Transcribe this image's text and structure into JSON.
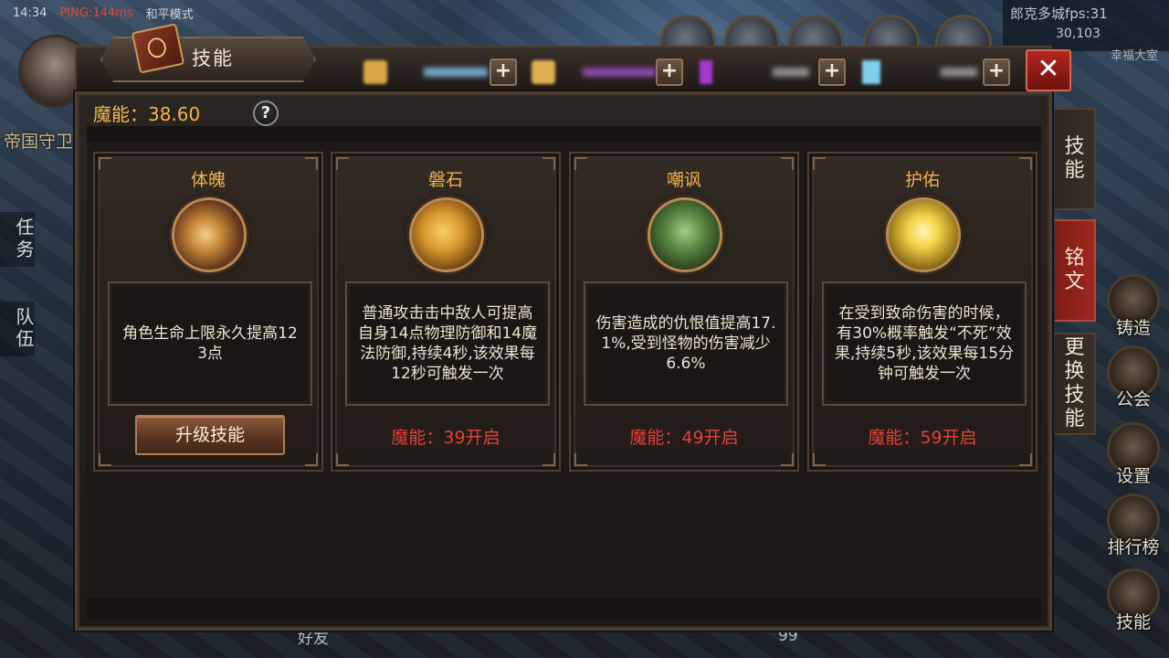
{
  "hud": {
    "time": "14:34",
    "ping": "PING:144ms",
    "mode": "和平模式",
    "city": "郎克多城fps:31",
    "coords": "30,103",
    "area": "幸福大室",
    "left_text": "帝国守卫",
    "left_tabs": [
      "任务",
      "队伍"
    ],
    "bottom_friends": "好友",
    "bottom_level": "99"
  },
  "right_menu": [
    {
      "label": "铸造",
      "icon": "forge-icon"
    },
    {
      "label": "公会",
      "icon": "guild-icon"
    },
    {
      "label": "设置",
      "icon": "settings-icon"
    },
    {
      "label": "排行榜",
      "icon": "trophy-icon"
    },
    {
      "label": "技能",
      "icon": "skill-book-icon"
    }
  ],
  "panel": {
    "title": "技能",
    "mana_label": "魔能：38.60",
    "help": "?",
    "close": "✕",
    "side_tabs": [
      "技能",
      "铭文",
      "更换技能"
    ],
    "active_tab": "铭文"
  },
  "colors": {
    "accent_orange": "#f0b24b",
    "locked_red": "#e0433a",
    "close_red": "#b3261e"
  },
  "cards": [
    {
      "title": "体魄",
      "icon": "strength-fist-icon",
      "desc": "角色生命上限永久提高123点",
      "action": "升级技能",
      "unlocked": true
    },
    {
      "title": "磐石",
      "icon": "shield-icon",
      "desc": "普通攻击击中敌人可提高自身14点物理防御和14魔法防御,持续4秒,该效果每12秒可触发一次",
      "requirement": "魔能：39开启",
      "unlocked": false
    },
    {
      "title": "嘲讽",
      "icon": "taunt-orc-icon",
      "desc": "伤害造成的仇恨值提高17.1%,受到怪物的伤害减少6.6%",
      "requirement": "魔能：49开启",
      "unlocked": false
    },
    {
      "title": "护佑",
      "icon": "holy-guard-icon",
      "desc": "在受到致命伤害的时候，有30%概率触发“不死”效果,持续5秒,该效果每15分钟可触发一次",
      "requirement": "魔能：59开启",
      "unlocked": false
    }
  ]
}
